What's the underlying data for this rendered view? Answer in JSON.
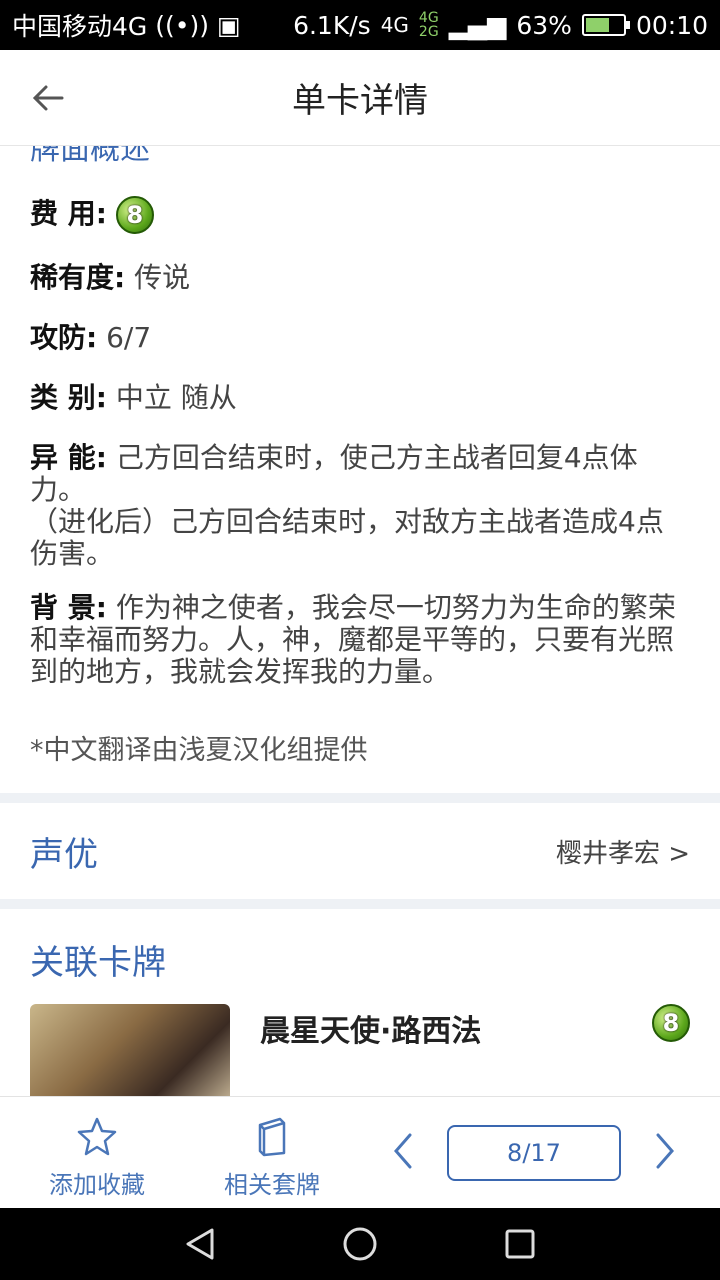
{
  "status_bar": {
    "carrier": "中国移动4G",
    "speed": "6.1K/s",
    "net_top": "4G",
    "net_small_top": "4G",
    "net_small_bottom": "2G",
    "battery": "63%",
    "battery_level": 0.63,
    "time": "00:10"
  },
  "app_bar": {
    "title": "单卡详情"
  },
  "overview": {
    "title": "牌面概述",
    "cost_label": "费 用:",
    "cost_value": "8",
    "rarity_label": "稀有度:",
    "rarity_value": "传说",
    "stats_label": "攻防:",
    "stats_value": "6/7",
    "type_label": "类 别:",
    "type_value": "中立 随从",
    "ability_label": "异 能:",
    "ability_value": "己方回合结束时，使己方主战者回复4点体力。",
    "ability_evolved": "（进化后）己方回合结束时，对敌方主战者造成4点伤害。",
    "lore_label": "背 景:",
    "lore_value": "作为神之使者，我会尽一切努力为生命的繁荣和幸福而努力。人，神，魔都是平等的，只要有光照到的地方，我就会发挥我的力量。",
    "note": "*中文翻译由浅夏汉化组提供"
  },
  "voice": {
    "title": "声优",
    "actor": "樱井孝宏 >"
  },
  "related": {
    "title": "关联卡牌",
    "items": [
      {
        "name": "晨星天使·路西法",
        "cost": "8"
      }
    ]
  },
  "bottom_bar": {
    "favorite_label": "添加收藏",
    "decks_label": "相关套牌",
    "pager": "8/17"
  },
  "colors": {
    "accent": "#3a67b0",
    "cost_green": "#5da81c"
  }
}
